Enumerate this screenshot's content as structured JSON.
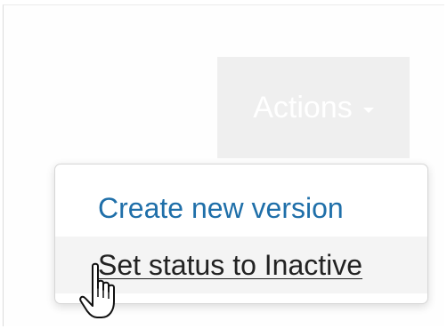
{
  "actions_button": {
    "label": "Actions",
    "icon": "caret-down-icon"
  },
  "dropdown": {
    "items": [
      {
        "label": "Create new version",
        "state": "normal",
        "color": "#1f6fa9"
      },
      {
        "label": "Set status to Inactive",
        "state": "hovered",
        "color": "#222222"
      }
    ]
  },
  "cursor": {
    "icon": "hand-pointer-icon"
  },
  "colors": {
    "button_bg": "#efefef",
    "link_blue": "#1f6fa9",
    "text_dark": "#222222",
    "hover_bg": "#f4f4f4"
  }
}
